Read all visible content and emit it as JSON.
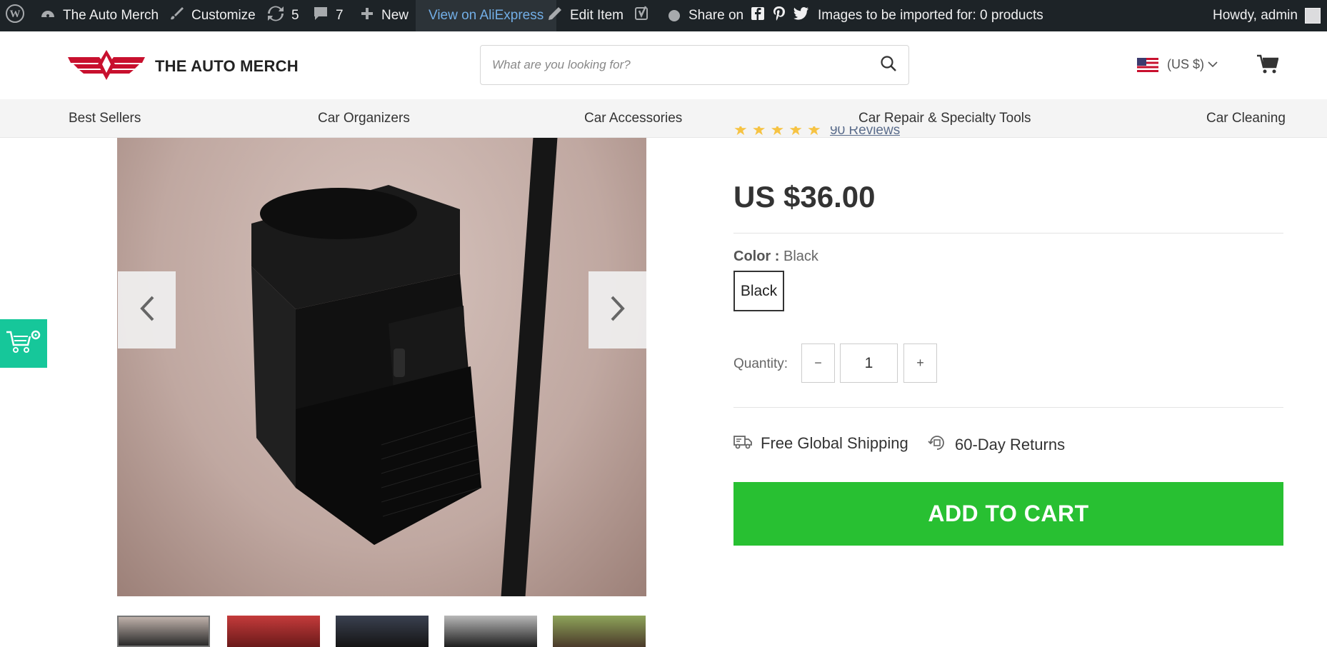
{
  "admin_bar": {
    "site_name": "The Auto Merch",
    "customize": "Customize",
    "updates_count": "5",
    "comments_count": "7",
    "new_label": "New",
    "view_aliexpress": "View on AliExpress",
    "edit_item": "Edit Item",
    "share_on": "Share on",
    "import_status": "Images to be imported for: 0 products",
    "greeting": "Howdy, admin",
    "icons": [
      "wordpress-icon",
      "dashboard-icon",
      "brush-icon",
      "refresh-icon",
      "comment-icon",
      "plus-icon",
      "pencil-icon",
      "yoast-icon",
      "status-dot-icon",
      "facebook-icon",
      "pinterest-icon",
      "twitter-icon"
    ]
  },
  "header": {
    "logo_text": "THE AUTO MERCH",
    "search_placeholder": "What are you looking for?",
    "currency": "(US $)"
  },
  "nav": {
    "items": [
      "Best Sellers",
      "Car Organizers",
      "Car Accessories",
      "Car Repair & Specialty Tools",
      "Car Cleaning"
    ]
  },
  "product": {
    "reviews_text": "90 Reviews",
    "price": "US $36.00",
    "color_label": "Color :",
    "color_value": "Black",
    "swatches": [
      "Black"
    ],
    "quantity_label": "Quantity:",
    "quantity_value": "1",
    "minus": "−",
    "plus": "+",
    "shipping": "Free Global Shipping",
    "returns": "60-Day Returns",
    "add_to_cart": "ADD TO CART"
  },
  "colors": {
    "admin_bar_bg": "#1d2327",
    "brand_red": "#c8102e",
    "cart_button": "#28c032",
    "float_tool": "#16c79a",
    "link_blue": "#72aee6"
  }
}
